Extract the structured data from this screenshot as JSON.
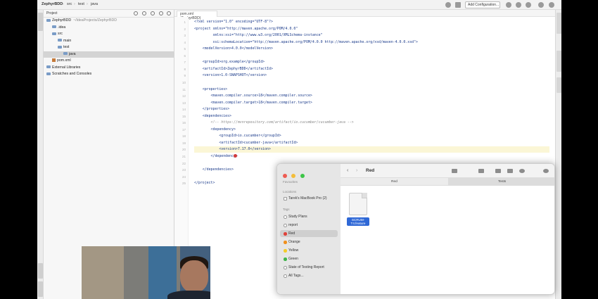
{
  "topbar": {
    "project": "ZephyrBDD",
    "crumbs": [
      "src",
      "test",
      "java"
    ],
    "run_config": "Add Configuration..."
  },
  "project_panel": {
    "title": "Project",
    "tree": [
      {
        "label": "ZephyrBDD",
        "path": "~/IdeaProjects/ZephyrBDD",
        "indent": 0,
        "type": "folder"
      },
      {
        "label": ".idea",
        "indent": 1,
        "type": "folder"
      },
      {
        "label": "src",
        "indent": 1,
        "type": "folder"
      },
      {
        "label": "main",
        "indent": 2,
        "type": "folder"
      },
      {
        "label": "test",
        "indent": 2,
        "type": "folder"
      },
      {
        "label": "java",
        "indent": 3,
        "type": "folder",
        "selected": true
      },
      {
        "label": "pom.xml",
        "indent": 1,
        "type": "file"
      },
      {
        "label": "External Libraries",
        "indent": 0,
        "type": "folder"
      },
      {
        "label": "Scratches and Consoles",
        "indent": 0,
        "type": "folder"
      }
    ]
  },
  "editor": {
    "tab": "pom.xml (ZephyrBDD)",
    "lines": [
      {
        "n": "1",
        "text": "<?xml version=\"1.0\" encoding=\"UTF-8\"?>"
      },
      {
        "n": "2",
        "text": "<project xmlns=\"http://maven.apache.org/POM/4.0.0\""
      },
      {
        "n": "3",
        "text": "         xmlns:xsi=\"http://www.w3.org/2001/XMLSchema-instance\""
      },
      {
        "n": "4",
        "text": "         xsi:schemaLocation=\"http://maven.apache.org/POM/4.0.0 http://maven.apache.org/xsd/maven-4.0.0.xsd\">"
      },
      {
        "n": "5",
        "text": "    <modelVersion>4.0.0</modelVersion>"
      },
      {
        "n": "6",
        "text": ""
      },
      {
        "n": "7",
        "text": "    <groupId>org.example</groupId>"
      },
      {
        "n": "8",
        "text": "    <artifactId>ZephyrBDD</artifactId>"
      },
      {
        "n": "9",
        "text": "    <version>1.0-SNAPSHOT</version>"
      },
      {
        "n": "10",
        "text": ""
      },
      {
        "n": "11",
        "text": "    <properties>"
      },
      {
        "n": "12",
        "text": "        <maven.compiler.source>18</maven.compiler.source>"
      },
      {
        "n": "13",
        "text": "        <maven.compiler.target>18</maven.compiler.target>"
      },
      {
        "n": "14",
        "text": "    </properties>"
      },
      {
        "n": "15",
        "text": "    <dependencies>"
      },
      {
        "n": "16",
        "text": "        <!-- https://mvnrepository.com/artifact/io.cucumber/cucumber-java -->",
        "comment": true
      },
      {
        "n": "17",
        "text": "        <dependency>"
      },
      {
        "n": "18",
        "text": "            <groupId>io.cucumber</groupId>"
      },
      {
        "n": "19",
        "text": "            <artifactId>cucumber-java</artifactId>"
      },
      {
        "n": "20",
        "text": "            <version>7.17.0</version>",
        "highlight": true
      },
      {
        "n": "21",
        "text": "        </dependency>"
      },
      {
        "n": "22",
        "text": ""
      },
      {
        "n": "23",
        "text": "    </dependencies>"
      },
      {
        "n": "24",
        "text": ""
      },
      {
        "n": "25",
        "text": "</project>"
      }
    ]
  },
  "finder": {
    "title": "Red",
    "path_left": "Red",
    "path_right": "Tests",
    "sections": {
      "favourites": "Favourites",
      "locations": "Locations",
      "tags": "Tags"
    },
    "location_item": "Tarek's MacBook Pro (2)",
    "tags": [
      {
        "label": "Study Plans",
        "color": ""
      },
      {
        "label": "report",
        "color": ""
      },
      {
        "label": "Red",
        "color": "#e0423a",
        "active": true
      },
      {
        "label": "Orange",
        "color": "#f0901e"
      },
      {
        "label": "Yellow",
        "color": "#f3cb2a"
      },
      {
        "label": "Green",
        "color": "#3fb44b"
      },
      {
        "label": "State of Testing Report",
        "color": ""
      },
      {
        "label": "All Tags...",
        "color": ""
      }
    ],
    "file_label_line1": "SCRUM-",
    "file_label_line2": "T4.feature"
  }
}
